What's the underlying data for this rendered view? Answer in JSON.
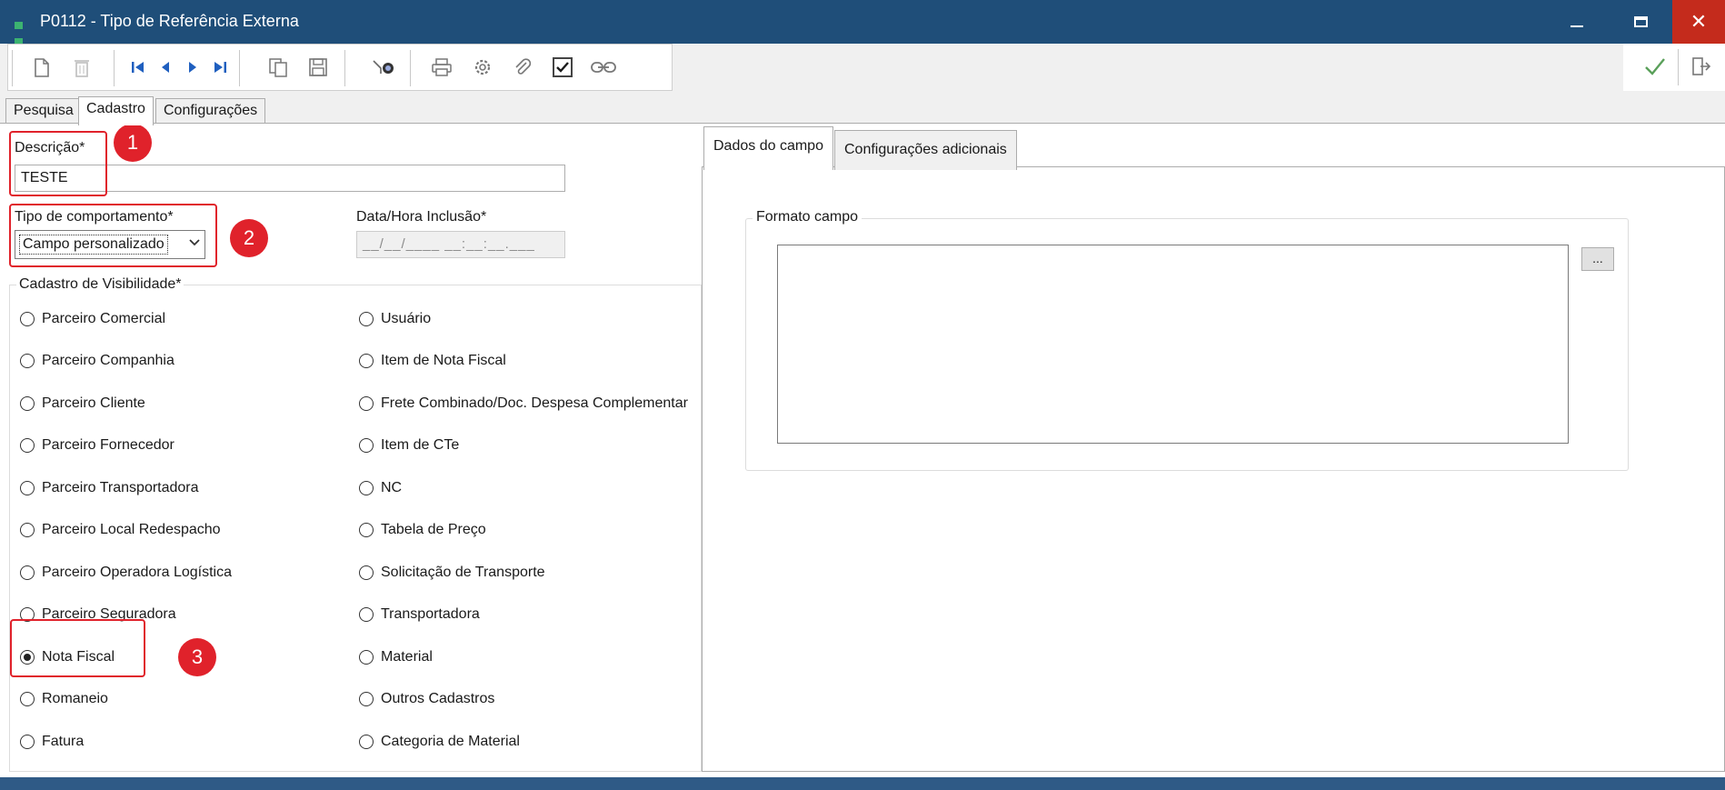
{
  "window": {
    "title": "P0112 - Tipo de Referência Externa",
    "min_icon": "minimize-icon",
    "max_icon": "maximize-icon",
    "close_glyph": "✕"
  },
  "toolbar": {
    "icons": [
      "new-document-icon",
      "delete-icon",
      "first-record-icon",
      "previous-record-icon",
      "next-record-icon",
      "last-record-icon",
      "copy-icon",
      "save-icon",
      "search-icon",
      "print-icon",
      "settings-icon",
      "attach-icon",
      "checkbox-icon",
      "link-icon",
      "confirm-icon",
      "exit-icon"
    ]
  },
  "tabs": [
    "Pesquisa",
    "Cadastro",
    "Configurações"
  ],
  "form": {
    "descricao_label": "Descrição*",
    "descricao_value": "TESTE",
    "tipo_label": "Tipo de comportamento*",
    "tipo_value": "Campo personalizado",
    "data_label": "Data/Hora Inclusão*",
    "data_placeholder": "__/__/____ __:__:__.___",
    "visibilidade_legend": "Cadastro de Visibilidade*"
  },
  "radios_left": [
    "Parceiro Comercial",
    "Parceiro Companhia",
    "Parceiro Cliente",
    "Parceiro Fornecedor",
    "Parceiro Transportadora",
    "Parceiro Local Redespacho",
    "Parceiro Operadora Logística",
    "Parceiro Seguradora",
    "Nota Fiscal",
    "Romaneio",
    "Fatura"
  ],
  "radios_right": [
    "Usuário",
    "Item de Nota Fiscal",
    "Frete Combinado/Doc. Despesa Complementar",
    "Item de CTe",
    "NC",
    "Tabela de Preço",
    "Solicitação de Transporte",
    "Transportadora",
    "Material",
    "Outros Cadastros",
    "Categoria de Material"
  ],
  "selected_radio": "Nota Fiscal",
  "right_panel": {
    "tabs": [
      "Dados do campo",
      "Configurações adicionais"
    ],
    "formato_legend": "Formato campo",
    "ellipsis": "..."
  },
  "annotations": [
    "1",
    "2",
    "3"
  ],
  "colors": {
    "titlebar": "#1f4e79",
    "close": "#c42b1c",
    "annotation": "#e0222b",
    "nav_icons": "#1f5fbf",
    "check_icon": "#3a9a3a"
  }
}
